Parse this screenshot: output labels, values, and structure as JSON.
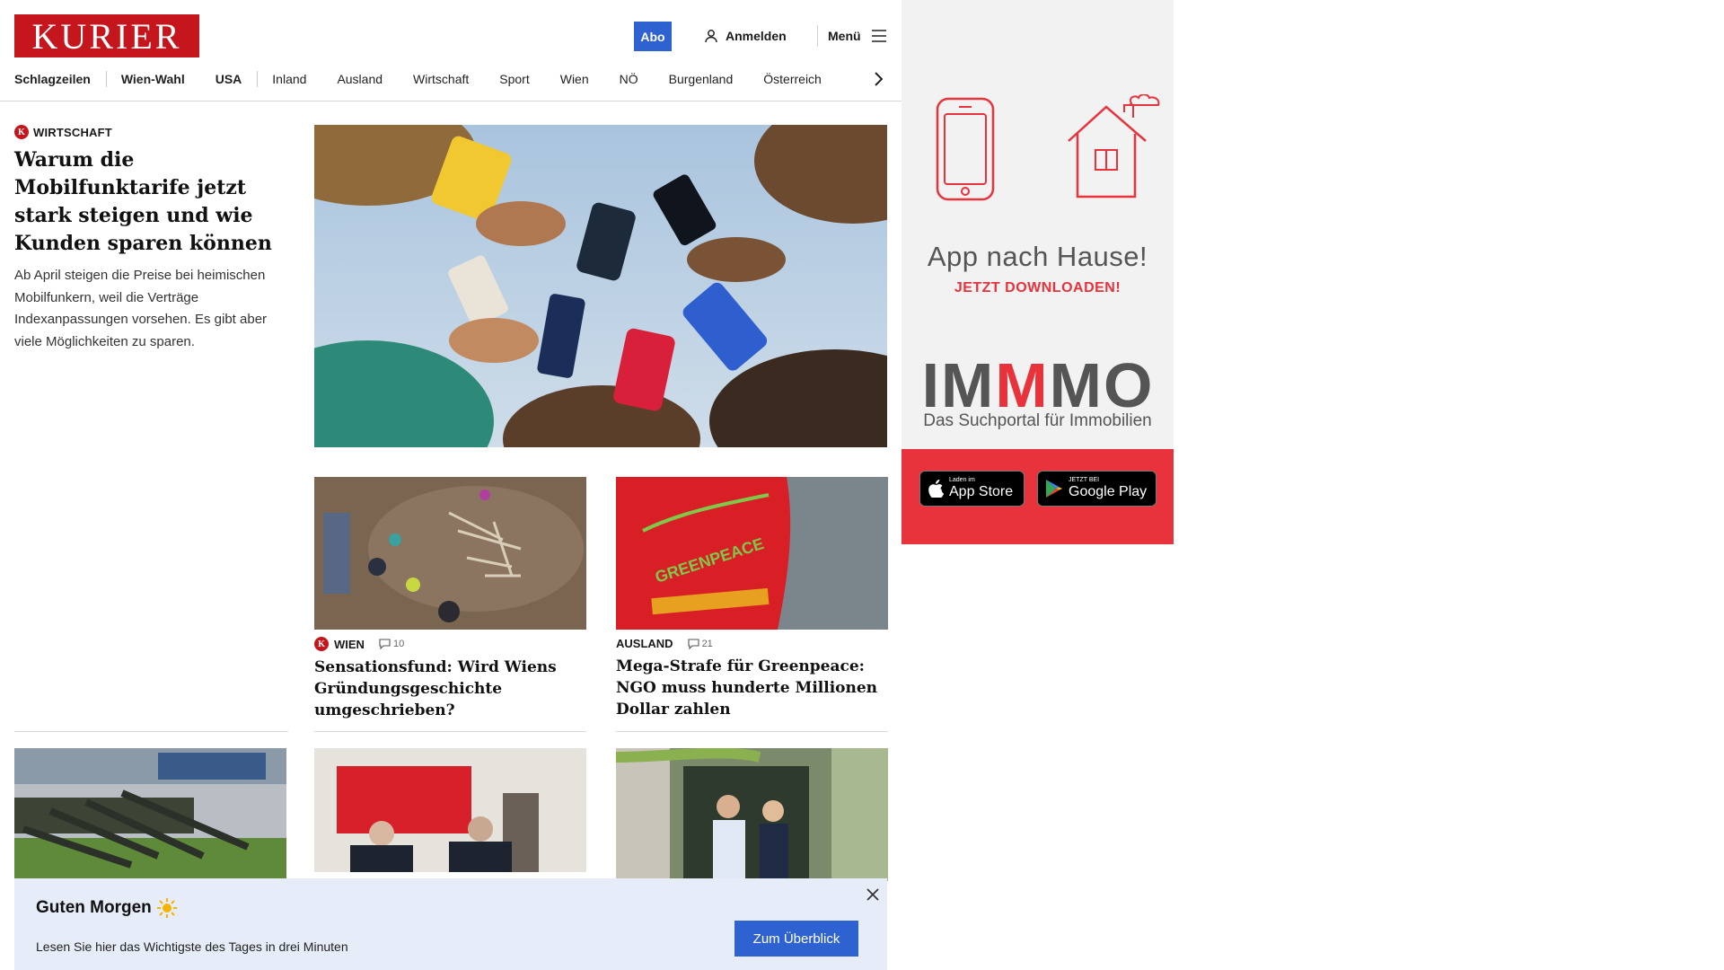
{
  "header": {
    "logo": "KURIER",
    "abo_label": "Abo",
    "login_label": "Anmelden",
    "menu_label": "Menü",
    "nav": [
      {
        "label": "Schlagzeilen",
        "bold": true
      },
      {
        "label": "Wien-Wahl",
        "bold": true
      },
      {
        "label": "USA",
        "bold": true
      },
      {
        "label": "Inland",
        "bold": false
      },
      {
        "label": "Ausland",
        "bold": false
      },
      {
        "label": "Wirtschaft",
        "bold": false
      },
      {
        "label": "Sport",
        "bold": false
      },
      {
        "label": "Wien",
        "bold": false
      },
      {
        "label": "NÖ",
        "bold": false
      },
      {
        "label": "Burgenland",
        "bold": false
      },
      {
        "label": "Österreich",
        "bold": false
      }
    ],
    "badge_letter": "K"
  },
  "lead": {
    "kicker": "WIRTSCHAFT",
    "title": "Warum die Mobilfunktarife jetzt stark steigen und wie Kunden sparen können",
    "teaser": "Ab April steigen die Preise bei heimischen Mobilfunkern, weil die Verträge Indexanpassungen vorsehen. Es gibt aber viele Möglichkeiten zu sparen."
  },
  "cards": [
    {
      "kicker": "WIEN",
      "comments": "10",
      "title": "Sensationsfund: Wird Wiens Gründungsgeschichte umgeschrieben?"
    },
    {
      "kicker": "AUSLAND",
      "comments": "21",
      "title": "Mega-Strafe für Greenpeace: NGO muss hunderte Millionen Dollar zahlen"
    }
  ],
  "ad": {
    "title": "App nach Hause!",
    "cta": "JETZT DOWNLOADEN!",
    "brand_left": "IM",
    "brand_accent": "M",
    "brand_right": "MO",
    "subtitle": "Das Suchportal für Immobilien",
    "appstore_small": "Laden im",
    "appstore_big": "App Store",
    "googleplay_small": "JETZT BEI",
    "googleplay_big": "Google Play",
    "image_text": "GREENPEACE"
  },
  "banner": {
    "title": "Guten Morgen",
    "text": "Lesen Sie hier das Wichtigste des Tages in drei Minuten",
    "button": "Zum Überblick"
  },
  "colors": {
    "brand_red": "#c4161c",
    "primary_blue": "#2f62d1",
    "ad_red": "#e8323c",
    "banner_bg": "#e7edf8"
  }
}
